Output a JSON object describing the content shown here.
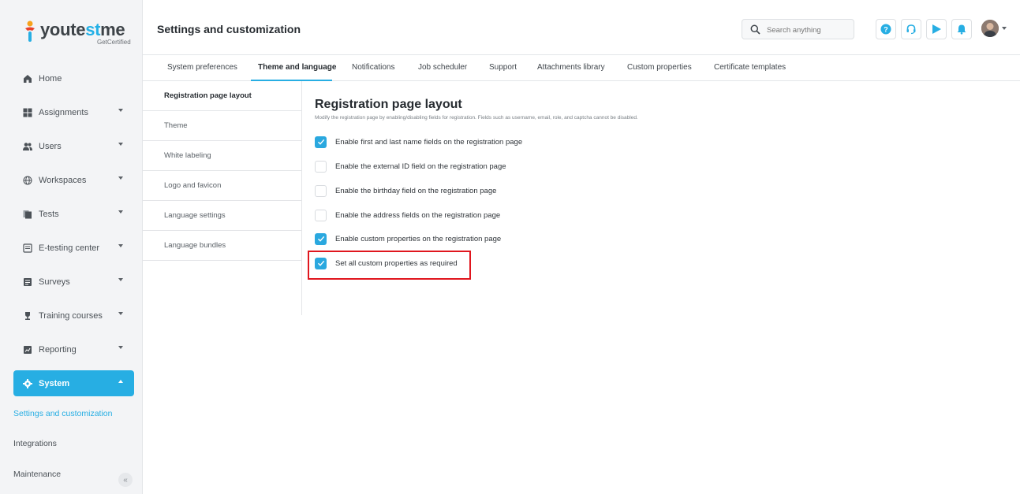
{
  "logo": {
    "part1": "youte",
    "part2": "st",
    "part3": "me",
    "sub": "GetCertified"
  },
  "header": {
    "title": "Settings and customization",
    "search_placeholder": "Search anything",
    "colors": {
      "accent": "#27aee3",
      "highlight": "#e0161e"
    }
  },
  "sidebar": {
    "items": [
      {
        "label": "Home",
        "icon": "home-icon"
      },
      {
        "label": "Assignments",
        "icon": "assignments-icon"
      },
      {
        "label": "Users",
        "icon": "users-icon"
      },
      {
        "label": "Workspaces",
        "icon": "globe-icon"
      },
      {
        "label": "Tests",
        "icon": "tests-icon"
      },
      {
        "label": "E-testing center",
        "icon": "e-testing-icon"
      },
      {
        "label": "Surveys",
        "icon": "surveys-icon"
      },
      {
        "label": "Training courses",
        "icon": "trophy-icon"
      },
      {
        "label": "Reporting",
        "icon": "reporting-icon"
      },
      {
        "label": "System",
        "icon": "gear-icon"
      }
    ],
    "sub_items": [
      {
        "label": "Settings and customization"
      },
      {
        "label": "Integrations"
      },
      {
        "label": "Maintenance"
      }
    ],
    "collapse_glyph": "«"
  },
  "tabs": [
    {
      "label": "System preferences"
    },
    {
      "label": "Theme and language"
    },
    {
      "label": "Notifications"
    },
    {
      "label": "Job scheduler"
    },
    {
      "label": "Support"
    },
    {
      "label": "Attachments library"
    },
    {
      "label": "Custom properties"
    },
    {
      "label": "Certificate templates"
    }
  ],
  "submenu": [
    {
      "label": "Registration page layout"
    },
    {
      "label": "Theme"
    },
    {
      "label": "White labeling"
    },
    {
      "label": "Logo and favicon"
    },
    {
      "label": "Language settings"
    },
    {
      "label": "Language bundles"
    }
  ],
  "content": {
    "title": "Registration page layout",
    "description": "Modify the registration page by enabling/disabling fields for registration. Fields such as username, email, role, and captcha cannot be disabled.",
    "options": [
      {
        "label": "Enable first and last name fields on the registration page",
        "checked": true
      },
      {
        "label": "Enable the external ID field on the registration page",
        "checked": false
      },
      {
        "label": "Enable the birthday field on the registration page",
        "checked": false
      },
      {
        "label": "Enable the address fields on the registration page",
        "checked": false
      },
      {
        "label": "Enable custom properties on the registration page",
        "checked": true
      },
      {
        "label": "Set all custom properties as required",
        "checked": true
      }
    ]
  }
}
